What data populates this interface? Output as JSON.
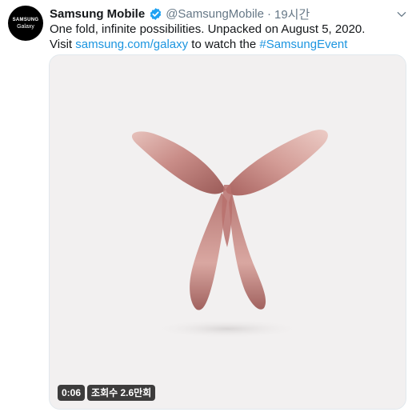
{
  "tweet": {
    "avatar": {
      "line1": "SAMSUNG",
      "line2": "Galaxy"
    },
    "author_name": "Samsung Mobile",
    "handle": "@SamsungMobile",
    "separator": "·",
    "time": "19시간",
    "text_line1": "One fold, infinite possibilities. Unpacked on August 5, 2020.",
    "text_prefix": "Visit ",
    "link_url": "samsung.com/galaxy",
    "text_middle": " to watch the ",
    "hashtag": "#SamsungEvent",
    "video": {
      "duration": "0:06",
      "views": "조회수 2.6만회"
    }
  },
  "colors": {
    "link": "#1b95e0",
    "verified": "#1da1f2",
    "muted": "#657786",
    "media_bg": "#f2f0f0"
  },
  "icons": [
    "verified-badge-icon",
    "chevron-down-icon"
  ]
}
